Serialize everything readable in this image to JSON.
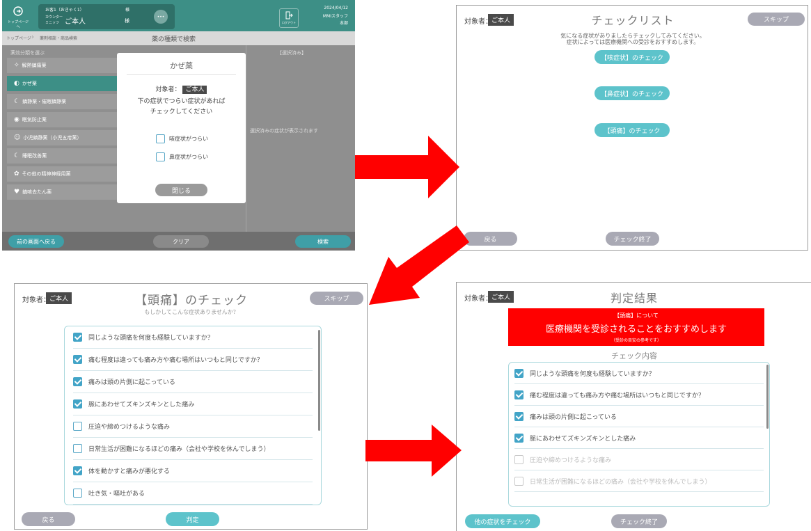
{
  "panel1": {
    "header": {
      "home_label": "トップページへ",
      "patient_id": "お客1（おきゃく1）",
      "patient_id_suffix": "様",
      "counter_label": "カウンター",
      "counter_sub": "ミニッツ",
      "patient_name": "ご本人",
      "patient_honorific": "様",
      "menu_label": "•••",
      "logout_label": "ログアウト",
      "date": "2024/04/12",
      "staff": "MMIスタッフ",
      "staff_sub": "本部"
    },
    "breadcrumb": {
      "item1": "トップページ",
      "item2": "薬剤相談・商品検索"
    },
    "page_title": "薬の種類で検索",
    "left_header": "薬効分類を選ぶ",
    "right_header": "【選択済み】",
    "categories": [
      {
        "label": "解熱鎮痛薬",
        "icon": "sparkle-icon"
      },
      {
        "label": "かぜ薬",
        "icon": "pill-icon"
      },
      {
        "label": "鎮静薬・催眠鎮静薬",
        "icon": "moon-icon"
      },
      {
        "label": "眠気防止薬",
        "icon": "eye-icon"
      },
      {
        "label": "小児鎮静薬（小児五疳薬）",
        "icon": "child-icon"
      },
      {
        "label": "睡眠改善薬",
        "icon": "sleep-icon"
      },
      {
        "label": "その他の精神神経用薬",
        "icon": "brain-icon"
      },
      {
        "label": "鎮咳去たん薬",
        "icon": "throat-icon"
      }
    ],
    "selected_category_index": 1,
    "right_placeholder": "選択済みの症状が表示されます",
    "dialog": {
      "title": "かぜ薬",
      "subject_label": "対象者：",
      "subject_value": "ご本人",
      "instruction_line1": "下の症状でつらい症状があれば",
      "instruction_line2": "チェックしてください",
      "options": [
        {
          "label": "咳症状がつらい",
          "checked": false
        },
        {
          "label": "鼻症状がつらい",
          "checked": false
        }
      ],
      "close_label": "閉じる"
    },
    "footer": {
      "back_label": "前の画面へ戻る",
      "clear_label": "クリア",
      "search_label": "検索"
    }
  },
  "panel2": {
    "subject_label": "対象者：",
    "subject_value": "ご本人",
    "title": "チェックリスト",
    "skip_label": "スキップ",
    "instruction_line1": "気になる症状がありましたらチェックしてみてください。",
    "instruction_line2": "症状によっては医療機関への受診をおすすめします。",
    "checks": [
      "【咳症状】のチェック",
      "【鼻症状】のチェック",
      "【頭痛】のチェック"
    ],
    "back_label": "戻る",
    "finish_label": "チェック終了"
  },
  "panel3": {
    "subject_label": "対象者：",
    "subject_value": "ご本人",
    "title": "【頭痛】のチェック",
    "subtitle": "もしかしてこんな症状ありませんか？",
    "skip_label": "スキップ",
    "items": [
      {
        "label": "同じような頭痛を何度も経験していますか？",
        "checked": true
      },
      {
        "label": "痛む程度は違っても痛み方や痛む場所はいつもと同じですか？",
        "checked": true
      },
      {
        "label": "痛みは頭の片側に起こっている",
        "checked": true
      },
      {
        "label": "脈にあわせてズキンズキンとした痛み",
        "checked": true
      },
      {
        "label": "圧迫や締めつけるような痛み",
        "checked": false
      },
      {
        "label": "日常生活が困難になるほどの痛み（会社や学校を休んでしまう）",
        "checked": false
      },
      {
        "label": "体を動かすと痛みが悪化する",
        "checked": true
      },
      {
        "label": "吐き気・嘔吐がある",
        "checked": false
      }
    ],
    "back_label": "戻る",
    "judge_label": "判定"
  },
  "panel4": {
    "subject_label": "対象者：",
    "subject_value": "ご本人",
    "title": "判定結果",
    "banner_line1": "【頭痛】について",
    "banner_line2": "医療機関を受診されることをおすすめします",
    "banner_line3": "（受診の目安の参考です）",
    "banner_color": "#ff0000",
    "section_title": "チェック内容",
    "items": [
      {
        "label": "同じような頭痛を何度も経験していますか？",
        "checked": true
      },
      {
        "label": "痛む程度は違っても痛み方や痛む場所はいつもと同じですか？",
        "checked": true
      },
      {
        "label": "痛みは頭の片側に起こっている",
        "checked": true
      },
      {
        "label": "脈にあわせてズキンズキンとした痛み",
        "checked": true
      },
      {
        "label": "圧迫や締めつけるような痛み",
        "checked": false
      },
      {
        "label": "日常生活が困難になるほどの痛み（会社や学校を休んでしまう）",
        "checked": false
      }
    ],
    "other_label": "他の症状をチェック",
    "finish_label": "チェック終了"
  },
  "colors": {
    "arrow": "#ff0000",
    "teal": "#5dc3cb",
    "header_green": "#3d8f86",
    "checkbox_blue": "#42a4c7"
  }
}
